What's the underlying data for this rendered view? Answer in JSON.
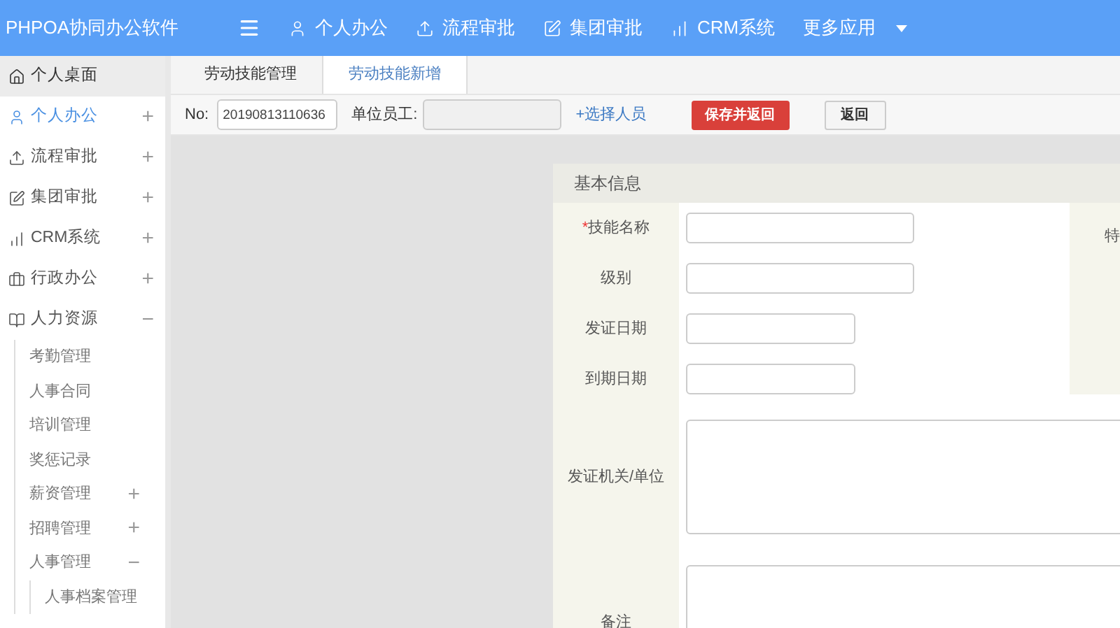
{
  "header": {
    "logo": "PHPOA协同办公软件",
    "nav": [
      {
        "label": "个人办公",
        "dropdown": false
      },
      {
        "label": "流程审批",
        "dropdown": false
      },
      {
        "label": "集团审批",
        "dropdown": false
      },
      {
        "label": "CRM系统",
        "dropdown": false
      },
      {
        "label": "更多应用",
        "dropdown": true
      }
    ]
  },
  "sidebar": {
    "items": [
      {
        "label": "个人桌面",
        "selected": true,
        "current": false
      },
      {
        "label": "个人办公",
        "selected": false,
        "current": true,
        "toggle": "+"
      },
      {
        "label": "流程审批",
        "selected": false,
        "current": false,
        "toggle": "+"
      },
      {
        "label": "集团审批",
        "selected": false,
        "current": false,
        "toggle": "+"
      },
      {
        "label": "CRM系统",
        "selected": false,
        "current": false,
        "toggle": "+"
      },
      {
        "label": "行政办公",
        "selected": false,
        "current": false,
        "toggle": "+"
      },
      {
        "label": "人力资源",
        "selected": false,
        "current": false,
        "toggle": "−",
        "children": [
          {
            "label": "考勤管理"
          },
          {
            "label": "人事合同"
          },
          {
            "label": "培训管理"
          },
          {
            "label": "奖惩记录"
          },
          {
            "label": "薪资管理",
            "toggle": "+"
          },
          {
            "label": "招聘管理",
            "toggle": "+"
          },
          {
            "label": "人事管理",
            "toggle": "−",
            "children": [
              {
                "label": "人事档案管理"
              }
            ]
          }
        ]
      }
    ]
  },
  "tabs": [
    {
      "label": "劳动技能管理",
      "selected": false
    },
    {
      "label": "劳动技能新增",
      "selected": true
    }
  ],
  "toolbar": {
    "no_label": "No:",
    "no_value": "20190813110636",
    "staff_label": "单位员工:",
    "pick_link": "+选择人员",
    "save_button": "保存并返回",
    "back_button": "返回"
  },
  "form": {
    "title": "基本信息",
    "fields": [
      {
        "label": "技能名称",
        "required_mark": "*"
      },
      {
        "label": "级别"
      },
      {
        "label": "发证日期"
      },
      {
        "label": "到期日期"
      }
    ],
    "side_label": "特",
    "areas": [
      {
        "label": "发证机关/单位"
      },
      {
        "label": "备注"
      }
    ]
  }
}
